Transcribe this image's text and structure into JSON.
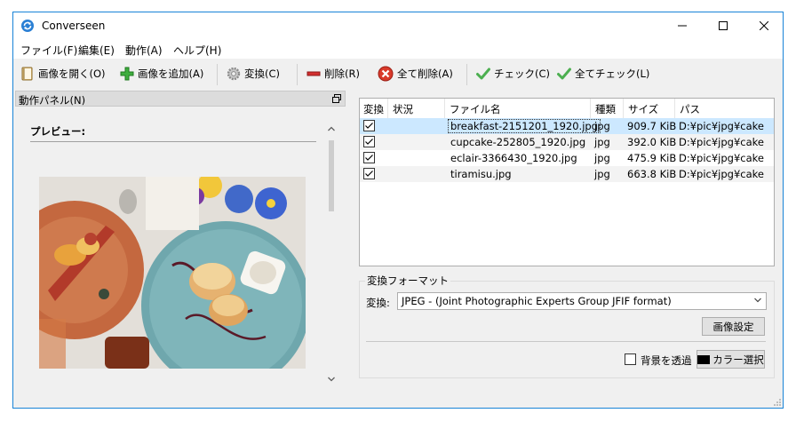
{
  "app": {
    "title": "Converseen"
  },
  "menu": {
    "file": "ファイル(F)",
    "edit": "編集(E)",
    "action": "動作(A)",
    "help": "ヘルプ(H)"
  },
  "toolbar": {
    "open_images": "画像を開く(O)",
    "add_images": "画像を追加(A)",
    "convert": "変換(C)",
    "remove": "削除(R)",
    "remove_all": "全て削除(A)",
    "check": "チェック(C)",
    "check_all": "全てチェック(L)"
  },
  "dock": {
    "title": "動作パネル(N)",
    "preview_label": "プレビュー:"
  },
  "table": {
    "columns": [
      "変換",
      "状況",
      "ファイル名",
      "種類",
      "サイズ",
      "パス"
    ],
    "rows": [
      {
        "checked": true,
        "status": "",
        "filename": "breakfast-2151201_1920.jpg",
        "type": "jpg",
        "size": "909.7 KiB",
        "path": "D:¥pic¥jpg¥cake"
      },
      {
        "checked": true,
        "status": "",
        "filename": "cupcake-252805_1920.jpg",
        "type": "jpg",
        "size": "392.0 KiB",
        "path": "D:¥pic¥jpg¥cake"
      },
      {
        "checked": true,
        "status": "",
        "filename": "eclair-3366430_1920.jpg",
        "type": "jpg",
        "size": "475.9 KiB",
        "path": "D:¥pic¥jpg¥cake"
      },
      {
        "checked": true,
        "status": "",
        "filename": "tiramisu.jpg",
        "type": "jpg",
        "size": "663.8 KiB",
        "path": "D:¥pic¥jpg¥cake"
      }
    ]
  },
  "format": {
    "group_title": "変換フォーマット",
    "label": "変換:",
    "selected": "JPEG - (Joint Photographic Experts Group JFIF format)",
    "image_settings": "画像設定",
    "transparent_label": "背景を透過",
    "transparent_checked": false,
    "color_select": "カラー選択"
  },
  "colors": {
    "window_border": "#1883d7",
    "selection": "#cce8ff",
    "remove_icon": "#d32f2f",
    "check_icon": "#4caf50"
  }
}
